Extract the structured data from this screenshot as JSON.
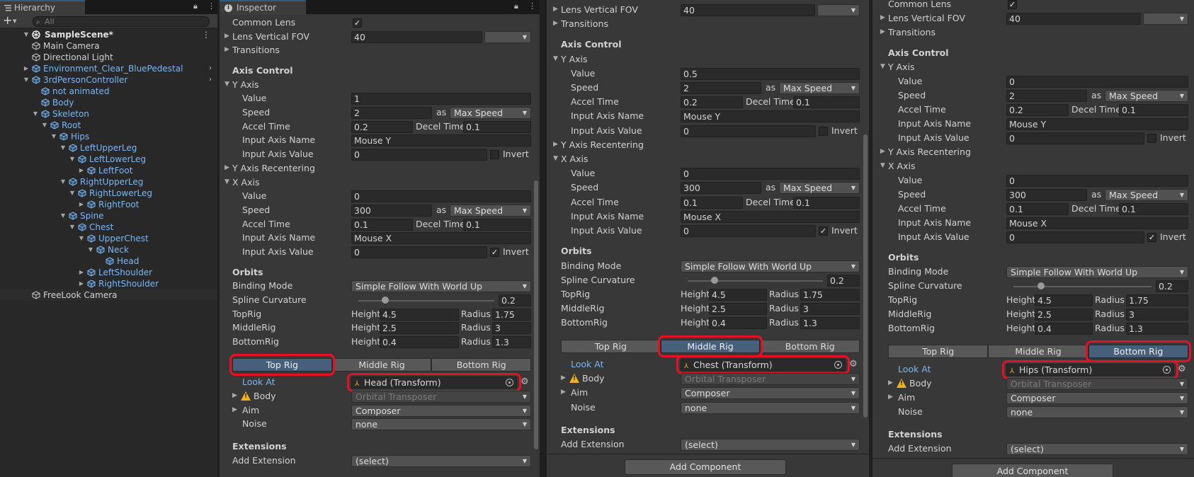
{
  "hierarchy": {
    "tab_label": "Hierarchy",
    "search_placeholder": "All",
    "add_label": "+",
    "scene_name": "SampleScene*",
    "items": [
      {
        "label": "Main Camera",
        "color": "white"
      },
      {
        "label": "Directional Light",
        "color": "white"
      },
      {
        "label": "Environment_Clear_BluePedestal",
        "color": "blue"
      },
      {
        "label": "3rdPersonController",
        "color": "blue"
      },
      {
        "label": "not animated",
        "color": "blue"
      },
      {
        "label": "Body",
        "color": "blue"
      },
      {
        "label": "Skeleton",
        "color": "blue"
      },
      {
        "label": "Root",
        "color": "blue"
      },
      {
        "label": "Hips",
        "color": "blue"
      },
      {
        "label": "LeftUpperLeg",
        "color": "blue"
      },
      {
        "label": "LeftLowerLeg",
        "color": "blue"
      },
      {
        "label": "LeftFoot",
        "color": "blue"
      },
      {
        "label": "RightUpperLeg",
        "color": "blue"
      },
      {
        "label": "RightLowerLeg",
        "color": "blue"
      },
      {
        "label": "RightFoot",
        "color": "blue"
      },
      {
        "label": "Spine",
        "color": "blue"
      },
      {
        "label": "Chest",
        "color": "blue"
      },
      {
        "label": "UpperChest",
        "color": "blue"
      },
      {
        "label": "Neck",
        "color": "blue"
      },
      {
        "label": "Head",
        "color": "blue"
      },
      {
        "label": "LeftShoulder",
        "color": "blue"
      },
      {
        "label": "RightShoulder",
        "color": "blue"
      },
      {
        "label": "FreeLook Camera",
        "color": "white"
      }
    ]
  },
  "inspector_tab_label": "Inspector",
  "labels": {
    "common_lens": "Common Lens",
    "lens_vfov": "Lens Vertical FOV",
    "transitions": "Transitions",
    "axis_control": "Axis Control",
    "y_axis": "Y Axis",
    "x_axis": "X Axis",
    "value": "Value",
    "speed": "Speed",
    "as": "as",
    "accel_time": "Accel Time",
    "decel_time": "Decel Time",
    "input_axis_name": "Input Axis Name",
    "input_axis_value": "Input Axis Value",
    "invert": "Invert",
    "y_axis_recentering": "Y Axis Recentering",
    "orbits": "Orbits",
    "binding_mode": "Binding Mode",
    "spline_curvature": "Spline Curvature",
    "top_rig": "TopRig",
    "middle_rig": "MiddleRig",
    "bottom_rig": "BottomRig",
    "height": "Height",
    "radius": "Radius",
    "tab_top": "Top Rig",
    "tab_middle": "Middle Rig",
    "tab_bottom": "Bottom Rig",
    "look_at": "Look At",
    "body": "Body",
    "aim": "Aim",
    "noise": "Noise",
    "extensions": "Extensions",
    "add_extension": "Add Extension",
    "add_component": "Add Component"
  },
  "inspectors": [
    {
      "lens_vfov": "40",
      "y_value": "1",
      "y_speed": "2",
      "y_speed_mode": "Max Speed",
      "y_accel": "0.2",
      "y_decel": "0.1",
      "y_input_name": "Mouse Y",
      "y_input_value": "0",
      "y_invert": false,
      "x_value": "0",
      "x_speed": "300",
      "x_speed_mode": "Max Speed",
      "x_accel": "0.1",
      "x_decel": "0.1",
      "x_input_name": "Mouse X",
      "x_input_value": "0",
      "x_invert": true,
      "binding_mode": "Simple Follow With World Up",
      "spline_curvature": "0.2",
      "spline_fraction": 0.2,
      "top_height": "4.5",
      "top_radius": "1.75",
      "mid_height": "2.5",
      "mid_radius": "3",
      "bot_height": "0.4",
      "bot_radius": "1.3",
      "selected_tab": "top",
      "look_at_target": "Head (Transform)",
      "body_value": "Orbital Transposer",
      "aim_value": "Composer",
      "noise_value": "none",
      "add_extension_value": "(select)"
    },
    {
      "lens_vfov": "40",
      "y_value": "0.5",
      "y_speed": "2",
      "y_speed_mode": "Max Speed",
      "y_accel": "0.2",
      "y_decel": "0.1",
      "y_input_name": "Mouse Y",
      "y_input_value": "0",
      "y_invert": false,
      "x_value": "0",
      "x_speed": "300",
      "x_speed_mode": "Max Speed",
      "x_accel": "0.1",
      "x_decel": "0.1",
      "x_input_name": "Mouse X",
      "x_input_value": "0",
      "x_invert": true,
      "binding_mode": "Simple Follow With World Up",
      "spline_curvature": "0.2",
      "spline_fraction": 0.2,
      "top_height": "4.5",
      "top_radius": "1.75",
      "mid_height": "2.5",
      "mid_radius": "3",
      "bot_height": "0.4",
      "bot_radius": "1.3",
      "selected_tab": "middle",
      "look_at_target": "Chest (Transform)",
      "body_value": "Orbital Transposer",
      "aim_value": "Composer",
      "noise_value": "none",
      "add_extension_value": "(select)"
    },
    {
      "lens_vfov": "40",
      "y_value": "0",
      "y_speed": "2",
      "y_speed_mode": "Max Speed",
      "y_accel": "0.2",
      "y_decel": "0.1",
      "y_input_name": "Mouse Y",
      "y_input_value": "0",
      "y_invert": false,
      "x_value": "0",
      "x_speed": "300",
      "x_speed_mode": "Max Speed",
      "x_accel": "0.1",
      "x_decel": "0.1",
      "x_input_name": "Mouse X",
      "x_input_value": "0",
      "x_invert": true,
      "binding_mode": "Simple Follow With World Up",
      "spline_curvature": "0.2",
      "spline_fraction": 0.2,
      "top_height": "4.5",
      "top_radius": "1.75",
      "mid_height": "2.5",
      "mid_radius": "3",
      "bot_height": "0.4",
      "bot_radius": "1.3",
      "selected_tab": "bottom",
      "look_at_target": "Hips (Transform)",
      "body_value": "Orbital Transposer",
      "aim_value": "Composer",
      "noise_value": "none",
      "add_extension_value": "(select)"
    }
  ],
  "colors": {
    "highlight": "#e81123",
    "selected_tab": "#46607c",
    "prefab_blue": "#7cb7f3"
  }
}
